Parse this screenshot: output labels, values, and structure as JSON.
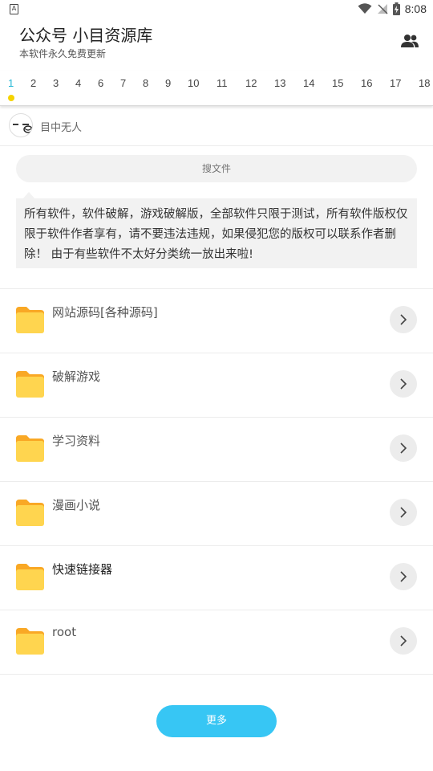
{
  "status_bar": {
    "left_icon": "A",
    "time": "8:08",
    "icons": [
      "wifi-icon",
      "signal-off-icon",
      "battery-charging-icon"
    ]
  },
  "header": {
    "title": "公众号 小目资源库",
    "subtitle": "本软件永久免费更新",
    "action_icon": "people-icon"
  },
  "tabs": {
    "active_index": 0,
    "items": [
      "1",
      "2",
      "3",
      "4",
      "6",
      "7",
      "8",
      "9",
      "10",
      "11",
      "12",
      "13",
      "14",
      "15",
      "16",
      "17",
      "18"
    ]
  },
  "user": {
    "name": "目中无人"
  },
  "search": {
    "placeholder": "搜文件"
  },
  "notice": {
    "text": "所有软件，软件破解，游戏破解版，全部软件只限于测试，所有软件版权仅限于软件作者享有，请不要违法违规，如果侵犯您的版权可以联系作者删除！ 由于有些软件不太好分类统一放出来啦!"
  },
  "folders": [
    {
      "label": "网站源码[各种源码]"
    },
    {
      "label": "破解游戏"
    },
    {
      "label": "学习资料"
    },
    {
      "label": "漫画小说"
    },
    {
      "label": "快速链接器"
    },
    {
      "label": "root"
    }
  ],
  "more_button": {
    "label": "更多"
  },
  "colors": {
    "accent": "#37c6f4",
    "tab_active": "#27b9d6",
    "tab_dot": "#f5d300",
    "folder": "#ffd54f",
    "folder_tab": "#f9a825"
  }
}
